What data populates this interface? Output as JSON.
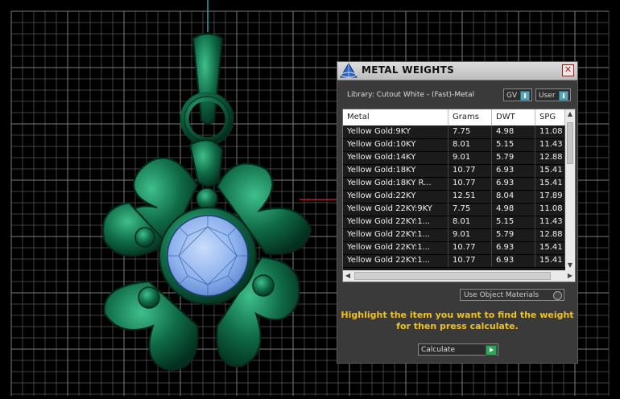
{
  "panel": {
    "title": "METAL WEIGHTS",
    "close_glyph": "✕",
    "library": "Library: Cutout White - (Fast)-Metal",
    "gv_label": "GV",
    "user_label": "User",
    "columns": [
      "Metal",
      "Grams",
      "DWT",
      "SPG"
    ],
    "rows": [
      [
        "Yellow Gold:9KY",
        "7.75",
        "4.98",
        "11.08"
      ],
      [
        "Yellow Gold:10KY",
        "8.01",
        "5.15",
        "11.43"
      ],
      [
        "Yellow Gold:14KY",
        "9.01",
        "5.79",
        "12.88"
      ],
      [
        "Yellow Gold:18KY",
        "10.77",
        "6.93",
        "15.41"
      ],
      [
        "Yellow Gold:18KY R...",
        "10.77",
        "6.93",
        "15.41"
      ],
      [
        "Yellow Gold:22KY",
        "12.51",
        "8.04",
        "17.89"
      ],
      [
        "Yellow Gold 22KY:9KY",
        "7.75",
        "4.98",
        "11.08"
      ],
      [
        "Yellow Gold 22KY:1...",
        "8.01",
        "5.15",
        "11.43"
      ],
      [
        "Yellow Gold 22KY:1...",
        "9.01",
        "5.79",
        "12.88"
      ],
      [
        "Yellow Gold 22KY:1...",
        "10.77",
        "6.93",
        "15.41"
      ],
      [
        "Yellow Gold 22KY:1...",
        "10.77",
        "6.93",
        "15.41"
      ]
    ],
    "use_object_materials": "Use Object Materials",
    "hint_line1": "Highlight the item you want to find the weight",
    "hint_line2": "for then press calculate.",
    "calculate_label": "Calculate"
  },
  "icons": {
    "close": "close-icon",
    "logo": "app-logo-icon",
    "toggle": "toggle-icon",
    "go": "play-arrow-icon"
  },
  "colors": {
    "viewport_bg": "#000000",
    "grid": "#7c7c7c",
    "model_green": "#0f6b47",
    "gem_blue": "#8fb3ee",
    "hint": "#f1c21a"
  }
}
